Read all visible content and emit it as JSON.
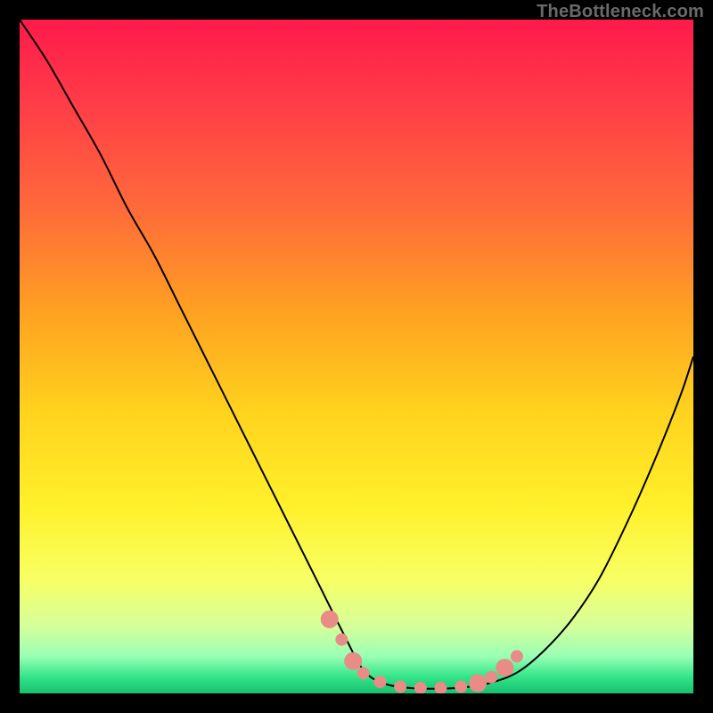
{
  "watermark": "TheBottleneck.com",
  "chart_data": {
    "type": "line",
    "title": "",
    "xlabel": "",
    "ylabel": "",
    "xlim": [
      0,
      100
    ],
    "ylim": [
      0,
      100
    ],
    "background_gradient": {
      "stops": [
        {
          "offset": 0.0,
          "color": "#ff1a4b"
        },
        {
          "offset": 0.12,
          "color": "#ff3b48"
        },
        {
          "offset": 0.28,
          "color": "#ff6a3a"
        },
        {
          "offset": 0.44,
          "color": "#ffa321"
        },
        {
          "offset": 0.58,
          "color": "#ffd21e"
        },
        {
          "offset": 0.72,
          "color": "#fff02a"
        },
        {
          "offset": 0.83,
          "color": "#f8ff63"
        },
        {
          "offset": 0.9,
          "color": "#d6ff9a"
        },
        {
          "offset": 0.945,
          "color": "#9affb5"
        },
        {
          "offset": 0.975,
          "color": "#35e58a"
        },
        {
          "offset": 1.0,
          "color": "#17c06e"
        }
      ]
    },
    "series": [
      {
        "name": "bottleneck-curve",
        "color": "#000000",
        "width": 2,
        "x": [
          0,
          4,
          8,
          12,
          16,
          20,
          24,
          28,
          32,
          36,
          40,
          44,
          48,
          51,
          54,
          58,
          62,
          66,
          70,
          74,
          78,
          82,
          86,
          90,
          94,
          98,
          100
        ],
        "y": [
          100,
          94,
          87,
          80,
          72,
          65,
          57,
          49,
          41,
          33,
          25,
          17,
          9,
          3.5,
          1.5,
          0.8,
          0.7,
          0.9,
          1.6,
          3.2,
          6.5,
          11,
          17,
          25,
          34,
          44,
          50
        ]
      }
    ],
    "markers": {
      "name": "highlight-dots",
      "color": "#e98b87",
      "radius_small": 7,
      "radius_large": 10,
      "points": [
        {
          "x": 46.0,
          "y": 11.0,
          "r": "large"
        },
        {
          "x": 47.8,
          "y": 8.0,
          "r": "small"
        },
        {
          "x": 49.5,
          "y": 4.8,
          "r": "large"
        },
        {
          "x": 51.0,
          "y": 3.0,
          "r": "small"
        },
        {
          "x": 53.5,
          "y": 1.7,
          "r": "small"
        },
        {
          "x": 56.5,
          "y": 1.0,
          "r": "small"
        },
        {
          "x": 59.5,
          "y": 0.8,
          "r": "small"
        },
        {
          "x": 62.5,
          "y": 0.8,
          "r": "small"
        },
        {
          "x": 65.5,
          "y": 1.0,
          "r": "small"
        },
        {
          "x": 68.0,
          "y": 1.5,
          "r": "large"
        },
        {
          "x": 70.0,
          "y": 2.4,
          "r": "small"
        },
        {
          "x": 72.0,
          "y": 3.8,
          "r": "large"
        },
        {
          "x": 73.8,
          "y": 5.5,
          "r": "small"
        }
      ]
    }
  }
}
